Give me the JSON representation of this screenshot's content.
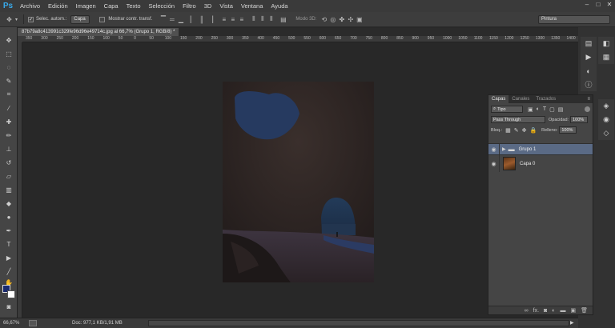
{
  "app": {
    "logo": "Ps"
  },
  "menu": [
    "Archivo",
    "Edición",
    "Imagen",
    "Capa",
    "Texto",
    "Selección",
    "Filtro",
    "3D",
    "Vista",
    "Ventana",
    "Ayuda"
  ],
  "window_controls": [
    "–",
    "□",
    "✕"
  ],
  "options": {
    "auto_select_label": "Selec. autom.:",
    "auto_select_value": "Capa",
    "show_transform_label": "Mostrar contr. transf.",
    "mode3d_label": "Modo 3D:",
    "workspace": "Pintura"
  },
  "document_tab": "87b79a8c413991c329fe96d96e49714c.jpg al 66,7% (Grupo 1, RGB/8) *",
  "rulers": {
    "h": [
      "350",
      "300",
      "250",
      "200",
      "150",
      "100",
      "50",
      "0",
      "50",
      "100",
      "150",
      "200",
      "250",
      "300",
      "350",
      "400",
      "450",
      "500",
      "550",
      "600",
      "650",
      "700",
      "750",
      "800",
      "850",
      "900",
      "950",
      "1000",
      "1050",
      "1100",
      "1150",
      "1200",
      "1250",
      "1300",
      "1350",
      "1400"
    ]
  },
  "status": {
    "zoom": "66,67%",
    "doc": "Doc: 977,1 KB/1,91 MB"
  },
  "layers_panel": {
    "tabs": [
      "Capas",
      "Canales",
      "Trazados"
    ],
    "filter_label": "Tipo",
    "blend_mode": "Pass Through",
    "opacity_label": "Opacidad:",
    "opacity_value": "100%",
    "lock_label": "Bloq.:",
    "fill_label": "Relleno:",
    "fill_value": "100%",
    "layers": [
      {
        "name": "Grupo 1",
        "type": "group",
        "selected": true
      },
      {
        "name": "Capa 0",
        "type": "image",
        "selected": false
      }
    ],
    "footer_icons": [
      "link-icon",
      "fx-icon",
      "mask-icon",
      "adjustment-icon",
      "folder-icon",
      "new-layer-icon",
      "trash-icon"
    ],
    "footer_fx": "fx."
  },
  "colors": {
    "foreground": "#1a2a6e",
    "background": "#ffffff",
    "accent": "#5a6a85"
  }
}
